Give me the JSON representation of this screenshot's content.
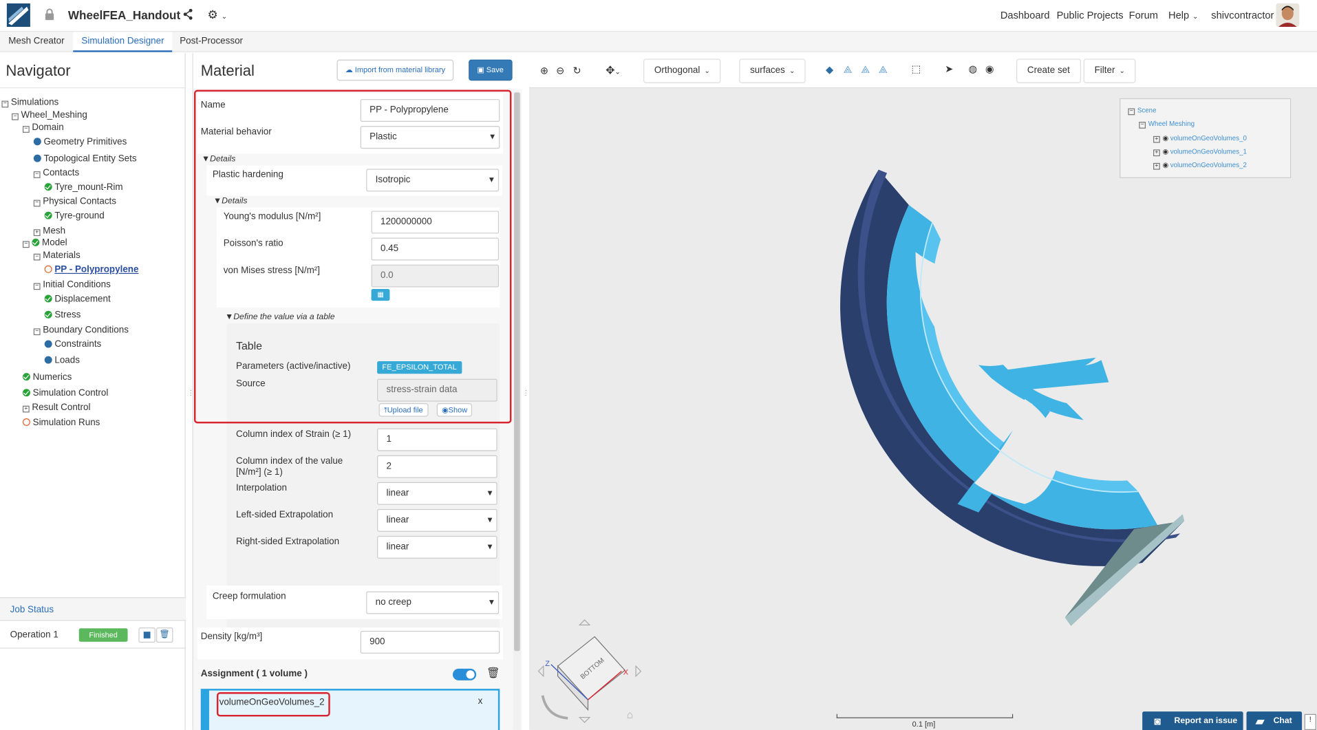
{
  "app": {
    "project_title": "WheelFEA_Handout",
    "user": "shivcontractor",
    "nav_links": [
      "Dashboard",
      "Public Projects",
      "Forum",
      "Help"
    ]
  },
  "tabs": [
    "Mesh Creator",
    "Simulation Designer",
    "Post-Processor"
  ],
  "navigator": {
    "title": "Navigator",
    "items": [
      {
        "label": "Simulations"
      },
      {
        "label": "Wheel_Meshing"
      },
      {
        "label": "Domain"
      },
      {
        "label": "Geometry Primitives"
      },
      {
        "label": "Topological Entity Sets"
      },
      {
        "label": "Contacts"
      },
      {
        "label": "Tyre_mount-Rim"
      },
      {
        "label": "Physical Contacts"
      },
      {
        "label": "Tyre-ground"
      },
      {
        "label": "Mesh"
      },
      {
        "label": "Model"
      },
      {
        "label": "Materials"
      },
      {
        "label": "PP - Polypropylene"
      },
      {
        "label": "Initial Conditions"
      },
      {
        "label": "Displacement"
      },
      {
        "label": "Stress"
      },
      {
        "label": "Boundary Conditions"
      },
      {
        "label": "Constraints"
      },
      {
        "label": "Loads"
      },
      {
        "label": "Numerics"
      },
      {
        "label": "Simulation Control"
      },
      {
        "label": "Result Control"
      },
      {
        "label": "Simulation Runs"
      }
    ]
  },
  "job_status": {
    "title": "Job Status",
    "operation": "Operation 1",
    "status": "Finished"
  },
  "material": {
    "title": "Material",
    "import_label": "Import from material library",
    "save_label": "Save",
    "name_label": "Name",
    "name_value": "PP  - Polypropylene",
    "behavior_label": "Material behavior",
    "behavior_value": "Plastic",
    "details_label": "Details",
    "hardening_label": "Plastic hardening",
    "hardening_value": "Isotropic",
    "details2_label": "Details",
    "youngs_label": "Young's modulus [N/m²]",
    "youngs_value": "1200000000",
    "poisson_label": "Poisson's ratio",
    "poisson_value": "0.45",
    "vonmises_label": "von Mises stress [N/m²]",
    "vonmises_value": "0.0",
    "define_table_label": "Define the value via a table",
    "table_title": "Table",
    "params_label": "Parameters (active/inactive)",
    "params_value": "FE_EPSILON_TOTAL",
    "source_label": "Source",
    "source_value": "stress-strain data",
    "upload_label": "Upload file",
    "show_label": "Show",
    "strain_col_label": "Column index of Strain (≥ 1)",
    "strain_col_value": "1",
    "value_col_label": "Column index of the value [N/m²] (≥ 1)",
    "value_col_value": "2",
    "interp_label": "Interpolation",
    "interp_value": "linear",
    "left_extrap_label": "Left-sided Extrapolation",
    "left_extrap_value": "linear",
    "right_extrap_label": "Right-sided Extrapolation",
    "right_extrap_value": "linear",
    "creep_label": "Creep formulation",
    "creep_value": "no creep",
    "density_label": "Density [kg/m³]",
    "density_value": "900",
    "assignment_label": "Assignment",
    "assignment_count": "( 1 volume )",
    "assigned_volume": "volumeOnGeoVolumes_2"
  },
  "viewer": {
    "projection": "Orthogonal",
    "render_mode": "surfaces",
    "create_set_label": "Create set",
    "filter_label": "Filter",
    "scene": {
      "root": "Scene",
      "child": "Wheel Meshing",
      "volumes": [
        "volumeOnGeoVolumes_0",
        "volumeOnGeoVolumes_1",
        "volumeOnGeoVolumes_2"
      ]
    },
    "scale_label": "0.1 [m]",
    "cube_label": "BOTTOM",
    "report_label": "Report an issue",
    "chat_label": "Chat",
    "colors": {
      "wheel_face": "#3fb3e3",
      "wheel_dark": "#2d3e6b",
      "highlight": "#d9232e"
    }
  }
}
